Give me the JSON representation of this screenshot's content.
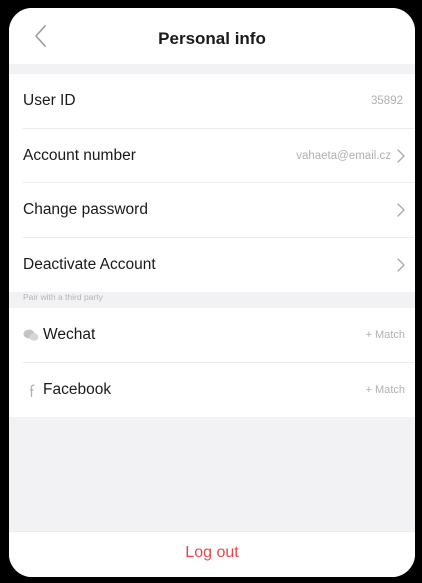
{
  "header": {
    "title": "Personal info",
    "back_icon": "chevron-left-icon"
  },
  "account": {
    "items": [
      {
        "label": "User ID",
        "value": "35892",
        "chevron": false
      },
      {
        "label": "Account number",
        "value": "vahaeta@email.cz",
        "chevron": true
      },
      {
        "label": "Change password",
        "value": "",
        "chevron": true
      },
      {
        "label": "Deactivate Account",
        "value": "",
        "chevron": true
      }
    ]
  },
  "third_party": {
    "section_label": "Pair with a third party",
    "items": [
      {
        "label": "Wechat",
        "action": "+ Match",
        "icon": "wechat-icon"
      },
      {
        "label": "Facebook",
        "action": "+ Match",
        "icon": "facebook-icon"
      }
    ]
  },
  "footer": {
    "logout_label": "Log out"
  },
  "colors": {
    "accent_red": "#e8474a",
    "background": "#f2f2f4",
    "muted_text": "#b0b0b4"
  }
}
